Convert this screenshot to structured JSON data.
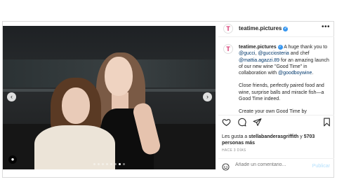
{
  "account": {
    "username": "teatime.pictures",
    "avatar_letter": "T"
  },
  "caption": {
    "username": "teatime.pictures",
    "paragraph1_prefix": "A huge thank you to ",
    "mention_gucci": "@gucci",
    "sep1": ", ",
    "mention_gucciosteria": "@gucciosteria",
    "mid1": " and chef ",
    "mention_chef": "@mattia.agazzi.89",
    "mid2": " for an amazing launch of our new wine \"Good Time\" in collaboration with ",
    "mention_wine": "@goodboywine",
    "end1": ".",
    "paragraph2": "Close friends, perfectly paired food and wine, surprise balls and miracle fish—a Good Time indeed.",
    "paragraph3": "Create your own Good Time by"
  },
  "likes": {
    "prefix": "Les gusta a ",
    "user": "stellabanderasgriffith",
    "middle": " y ",
    "count": "5703 personas más"
  },
  "timestamp": "HACE 3 DÍAS",
  "comment": {
    "placeholder": "Añade un comentario...",
    "publish_label": "Publicar"
  },
  "carousel": {
    "slides": 8,
    "active_index": 6
  },
  "icons": {
    "like": "heart-icon",
    "comment": "comment-icon",
    "share": "paper-plane-icon",
    "save": "bookmark-icon",
    "emoji": "emoji-icon",
    "more": "more-options-icon",
    "verified": "verified-badge-icon",
    "user_tag": "user-tag-icon"
  },
  "colors": {
    "link": "#00376b",
    "verified": "#3897f0",
    "publish_disabled": "#b2dffc",
    "brand_avatar": "#d62e6b"
  }
}
